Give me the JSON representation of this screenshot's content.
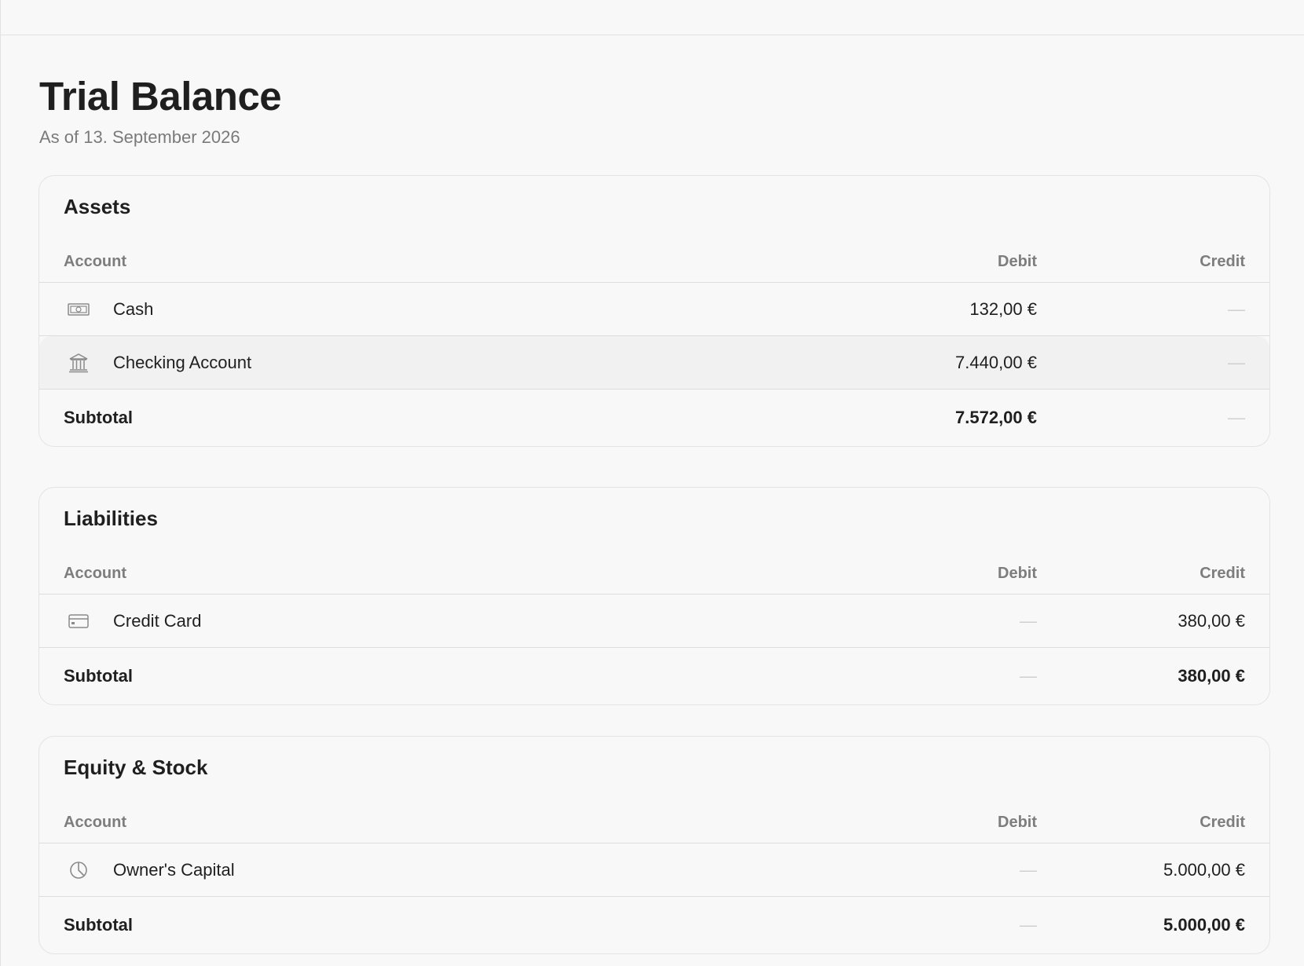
{
  "page": {
    "title": "Trial Balance",
    "subtitle": "As of 13. September 2026"
  },
  "columns": {
    "account": "Account",
    "debit": "Debit",
    "credit": "Credit"
  },
  "sections": [
    {
      "title": "Assets",
      "rows": [
        {
          "icon": "cash-icon",
          "name": "Cash",
          "debit": "132,00 €",
          "credit": "—"
        },
        {
          "icon": "bank-icon",
          "name": "Checking Account",
          "debit": "7.440,00 €",
          "credit": "—"
        }
      ],
      "subtotal": {
        "label": "Subtotal",
        "debit": "7.572,00 €",
        "credit": "—"
      }
    },
    {
      "title": "Liabilities",
      "rows": [
        {
          "icon": "credit-card-icon",
          "name": "Credit Card",
          "debit": "—",
          "credit": "380,00 €"
        }
      ],
      "subtotal": {
        "label": "Subtotal",
        "debit": "—",
        "credit": "380,00 €"
      }
    },
    {
      "title": "Equity & Stock",
      "rows": [
        {
          "icon": "pie-chart-icon",
          "name": "Owner's Capital",
          "debit": "—",
          "credit": "5.000,00 €"
        }
      ],
      "subtotal": {
        "label": "Subtotal",
        "debit": "—",
        "credit": "5.000,00 €"
      }
    }
  ],
  "colors": {
    "background": "#f8f8f8",
    "text": "#1f1f1f",
    "muted": "#7a7a7a",
    "dash": "#cfcfcf",
    "border": "#dddddd",
    "highlight_row": "#f1f1f1"
  }
}
